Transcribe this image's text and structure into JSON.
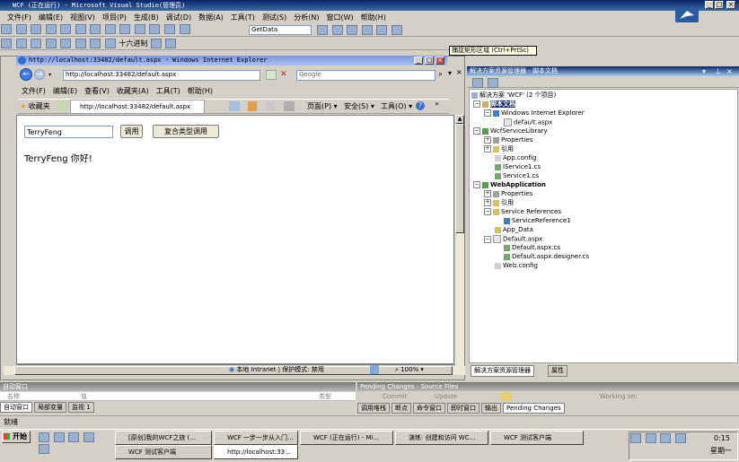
{
  "vs": {
    "title": "WCF (正在运行) - Microsoft Visual Studio(管理员)",
    "menus": [
      "文件(F)",
      "编辑(E)",
      "视图(V)",
      "项目(P)",
      "生成(B)",
      "调试(D)",
      "数据(A)",
      "工具(T)",
      "测试(S)",
      "分析(N)",
      "窗口(W)",
      "帮助(H)"
    ],
    "config_combo": "GetData",
    "hex_label": "十六进制",
    "tooltip": "捕捉矩形区域 (Ctrl+PrtSc)"
  },
  "ie": {
    "title": "http://localhost:33482/default.aspx - Windows Internet Explorer",
    "address": "http://localhost:33482/default.aspx",
    "search_placeholder": "Google",
    "menus": [
      "文件(F)",
      "编辑(E)",
      "查看(V)",
      "收藏夹(A)",
      "工具(T)",
      "帮助(H)"
    ],
    "favorites": "收藏夹",
    "tab": "http://localhost:33482/default.aspx",
    "cmd_page": "页面(P)",
    "cmd_safety": "安全(S)",
    "cmd_tools": "工具(O)",
    "name_input": "TerryFeng",
    "call_button": "调用",
    "complex_button": "复合类型调用",
    "result": "TerryFeng 你好!",
    "status_zone": "本地 Intranet | 保护模式: 禁用",
    "zoom": "100%"
  },
  "solution": {
    "header": "解决方案资源管理器 - 脚本文档",
    "items": [
      {
        "label": "解决方案 'WCF' (2 个项目)",
        "bold": false
      },
      {
        "label": "脚本文档",
        "bold": true
      },
      {
        "label": "Windows Internet Explorer",
        "bold": false
      },
      {
        "label": "default.aspx",
        "bold": false
      },
      {
        "label": "WcfServiceLibrary",
        "bold": false
      },
      {
        "label": "Properties",
        "bold": false
      },
      {
        "label": "引用",
        "bold": false
      },
      {
        "label": "App.config",
        "bold": false
      },
      {
        "label": "IService1.cs",
        "bold": false
      },
      {
        "label": "Service1.cs",
        "bold": false
      },
      {
        "label": "WebApplication",
        "bold": true
      },
      {
        "label": "Properties",
        "bold": false
      },
      {
        "label": "引用",
        "bold": false
      },
      {
        "label": "Service References",
        "bold": false
      },
      {
        "label": "ServiceReference1",
        "bold": false
      },
      {
        "label": "App_Data",
        "bold": false
      },
      {
        "label": "Default.aspx",
        "bold": false
      },
      {
        "label": "Default.aspx.cs",
        "bold": false
      },
      {
        "label": "Default.aspx.designer.cs",
        "bold": false
      },
      {
        "label": "Web.config",
        "bold": false
      }
    ],
    "tab_explorer": "解决方案资源管理器",
    "tab_props": "属性"
  },
  "autos": {
    "header": "自动窗口",
    "col_name": "名称",
    "col_value": "值",
    "col_type": "类型",
    "tabs": [
      "自动窗口",
      "局部变量",
      "监视 1"
    ]
  },
  "pending": {
    "header": "Pending Changes - Source Files",
    "commit": "Commit",
    "update": "Update",
    "working_on": "Working on:",
    "tabs": [
      "调用堆栈",
      "断点",
      "命令窗口",
      "即时窗口",
      "输出",
      "Pending Changes"
    ]
  },
  "status_ready": "就绪",
  "taskbar": {
    "start": "开始",
    "row1": [
      "[原创]我的WCF之旅 (...",
      "WCF 一步一步从入门...",
      "WCF (正在运行) - Mi...",
      "演练: 创建和访问 WC...",
      "WCF 测试客户端"
    ],
    "row2": [
      "WCF 测试客户端",
      "http://localhost:33..."
    ],
    "time": "0:15",
    "day": "星期一"
  }
}
